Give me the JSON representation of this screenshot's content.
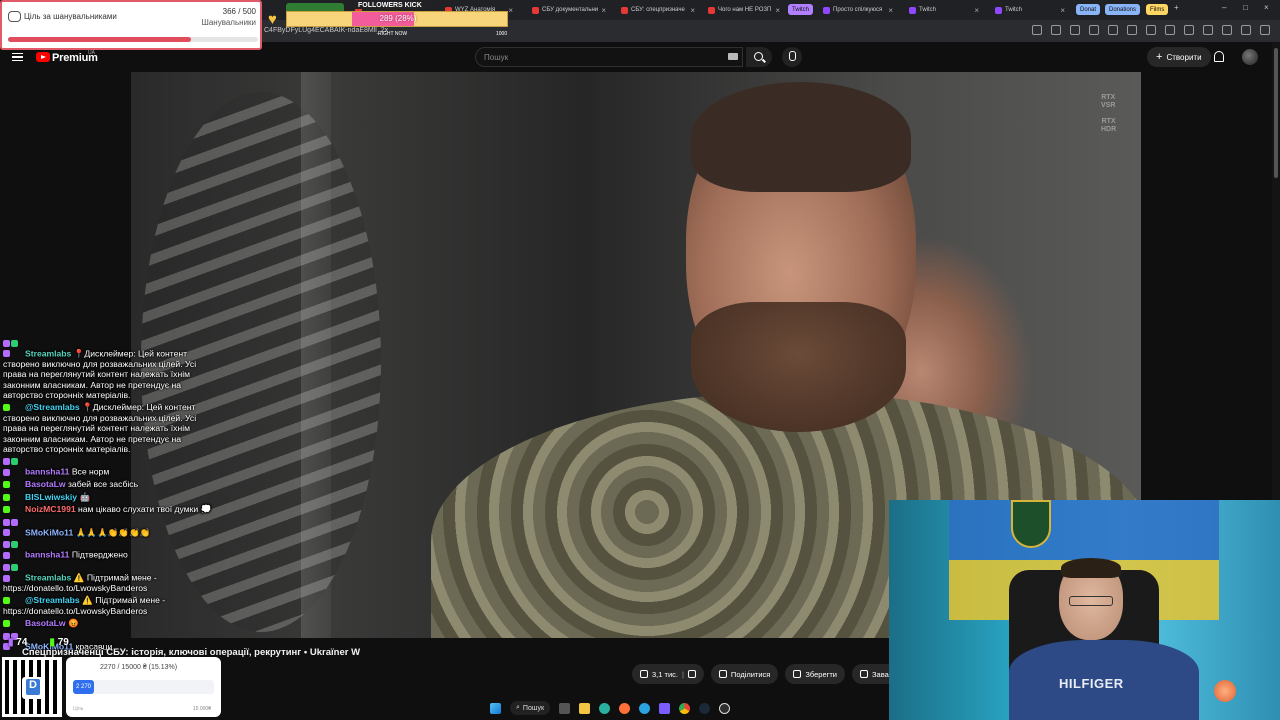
{
  "browser": {
    "tabs": [
      {
        "label": "",
        "color": "#2e7d32"
      },
      {
        "label": "",
        "color": "#e53935"
      },
      {
        "label": "WYZ Анатомія",
        "color": "#e53935"
      },
      {
        "label": "СБУ документальни",
        "color": "#e53935"
      },
      {
        "label": "СБУ: спецпризначе",
        "color": "#e53935"
      },
      {
        "label": "Чого нам НЕ РОЗП",
        "color": "#e53935"
      },
      {
        "label": "Просто спілкуюся",
        "color": "#9146ff"
      },
      {
        "label": "Twitch",
        "color": "#9146ff"
      },
      {
        "label": "Twitch",
        "color": "#9146ff"
      }
    ],
    "pills": [
      "Twitch",
      "Donat",
      "Donations",
      "Films"
    ],
    "address_fragment": "C4FByDFyLUg4ECABAIK-ndaE8Mll_2x"
  },
  "followers_goal": {
    "title": "Ціль за шанувальниками",
    "current": 366,
    "target": 500,
    "count_text": "366 / 500",
    "subtitle": "Шанувальники",
    "progress": 0.732
  },
  "followers_kick": {
    "label": "FOLLOWERS KICK",
    "progress_text": "289 (28%)",
    "progress": 0.28,
    "right_now": "RIGHT NOW",
    "max": "1000"
  },
  "youtube": {
    "logo_text": "Premium",
    "region": "UA",
    "search_placeholder": "Пошук",
    "create_label": "Створити"
  },
  "video": {
    "title": "Спецпризначенці СБУ: історія, ключові операції, рекрутинг • Ukraїner W",
    "rtx_vsr": [
      "RTX",
      "VSR"
    ],
    "rtx_hdr": [
      "RTX",
      "HDR"
    ],
    "actions": {
      "likes": "3,1 тис.",
      "share": "Поділитися",
      "save": "Зберегти",
      "download": "Завант"
    }
  },
  "chat": {
    "messages": [
      {
        "user": "Streamlabs",
        "color_class": "c-teal",
        "badges": [
          "b-p",
          "b-g",
          "b-p"
        ],
        "text": "📍Дисклеймер: Цей контент створено виключно для розважальних цілей. Усі права на переглянутий контент належать їхнім законним власникам. Автор не претендує на авторство сторонніх матеріалів."
      },
      {
        "user": "@Streamlabs",
        "color_class": "c-cyan",
        "badges": [
          "b-k"
        ],
        "text": "📍Дисклеймер: Цей контент створено виключно для розважальних цілей. Усі права на переглянутий контент належать їхнім законним власникам. Автор не претендує на авторство сторонніх матеріалів."
      },
      {
        "user": "bannsha11",
        "color_class": "c-purple",
        "badges": [
          "b-p",
          "b-g",
          "b-p"
        ],
        "text": "Все норм"
      },
      {
        "user": "BasotaLw",
        "color_class": "c-purple",
        "badges": [
          "b-k"
        ],
        "text": "забей все засбісь"
      },
      {
        "user": "BISLwiwskiy",
        "color_class": "c-cyan",
        "badges": [
          "b-k"
        ],
        "text": "🤖"
      },
      {
        "user": "NoizMC1991",
        "color_class": "c-red",
        "badges": [
          "b-k"
        ],
        "text": "нам цікаво слухати твої думки 💭"
      },
      {
        "user": "SMoKiMo11",
        "color_class": "c-blue",
        "badges": [
          "b-p",
          "b-p",
          "b-p"
        ],
        "text": "🙏🙏🙏👏👏👏👏"
      },
      {
        "user": "bannsha11",
        "color_class": "c-purple",
        "badges": [
          "b-p",
          "b-g",
          "b-p"
        ],
        "text": "Підтверджено"
      },
      {
        "user": "Streamlabs",
        "color_class": "c-teal",
        "badges": [
          "b-p",
          "b-g",
          "b-p"
        ],
        "text": "⚠️ Підтримай мене - https://donatello.to/LwowskyBanderos"
      },
      {
        "user": "@Streamlabs",
        "color_class": "c-cyan",
        "badges": [
          "b-k"
        ],
        "text": "⚠️ Підтримай мене - https://donatello.to/LwowskyBanderos"
      },
      {
        "user": "BasotaLw",
        "color_class": "c-purple",
        "badges": [
          "b-k"
        ],
        "text": "😡"
      },
      {
        "user": "SMoKiMo11",
        "color_class": "c-blue",
        "badges": [
          "b-p",
          "b-p",
          "b-p"
        ],
        "text": "красавци"
      }
    ],
    "viewer_counts": {
      "twitch": "74",
      "kick": "79"
    }
  },
  "donation": {
    "amount_text": "2270 / 15000 ₴ (15.13%)",
    "bar_label": "2 270",
    "progress": 0.1513,
    "goal_label": "Ціль",
    "max_text": "15 000₴"
  },
  "webcam": {
    "shirt_text": "HILFIGER"
  },
  "taskbar": {
    "search_label": "Пошук"
  }
}
